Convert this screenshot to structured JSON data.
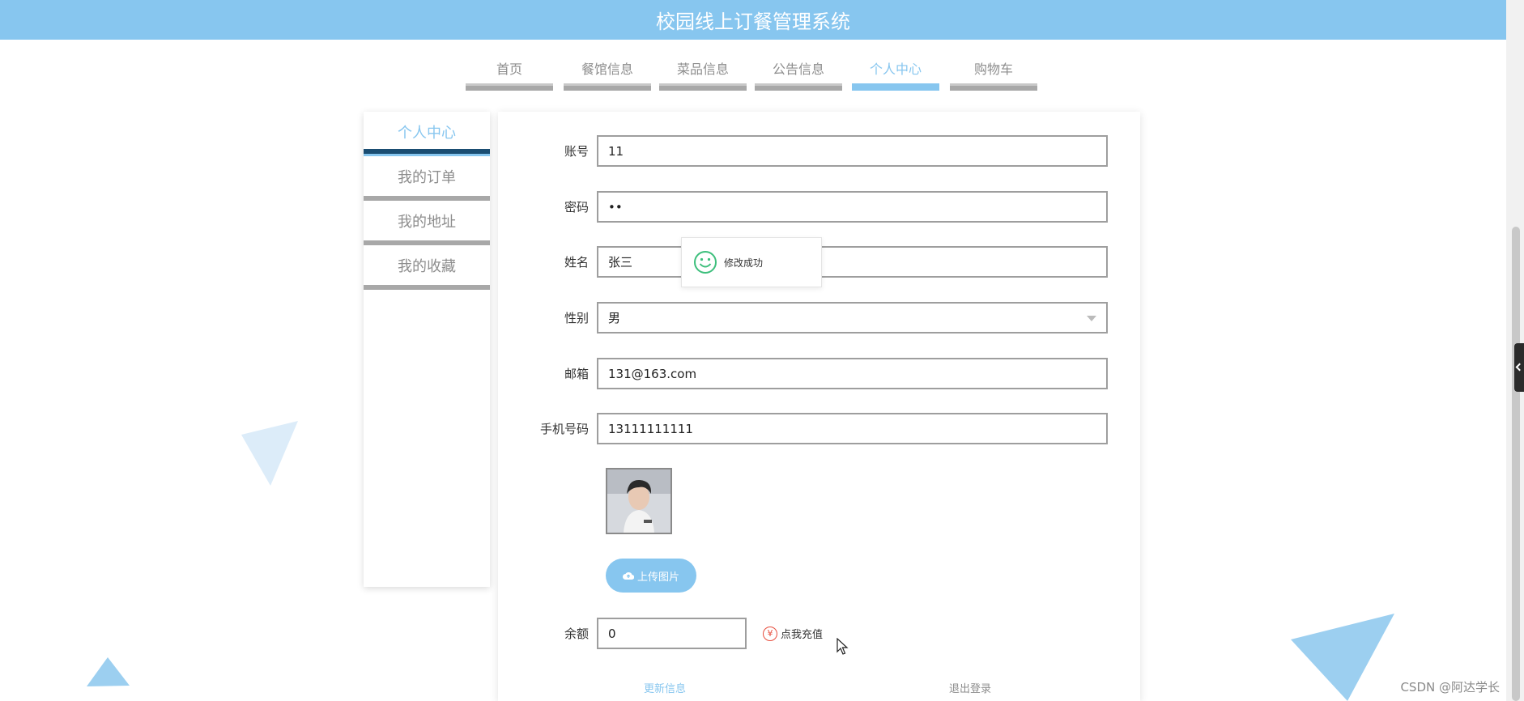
{
  "app": {
    "title": "校园线上订餐管理系统"
  },
  "nav": {
    "items": [
      {
        "label": "首页"
      },
      {
        "label": "餐馆信息"
      },
      {
        "label": "菜品信息"
      },
      {
        "label": "公告信息"
      },
      {
        "label": "个人中心"
      },
      {
        "label": "购物车"
      }
    ],
    "active_index": 4
  },
  "sidebar": {
    "items": [
      {
        "label": "个人中心"
      },
      {
        "label": "我的订单"
      },
      {
        "label": "我的地址"
      },
      {
        "label": "我的收藏"
      }
    ],
    "active_index": 0
  },
  "form": {
    "account": {
      "label": "账号",
      "value": "11"
    },
    "password": {
      "label": "密码",
      "value": "••"
    },
    "name": {
      "label": "姓名",
      "value": "张三"
    },
    "gender": {
      "label": "性别",
      "value": "男"
    },
    "email": {
      "label": "邮箱",
      "value": "131@163.com"
    },
    "phone": {
      "label": "手机号码",
      "value": "13111111111"
    },
    "upload_button": "上传图片",
    "balance": {
      "label": "余额",
      "value": "0"
    },
    "recharge_label": "点我充值",
    "update_label": "更新信息",
    "logout_label": "退出登录"
  },
  "toast": {
    "message": "修改成功"
  },
  "watermark": "CSDN @阿达学长",
  "colors": {
    "accent": "#87c6ef",
    "active_bar": "#1a4d72",
    "success": "#3dbf7c",
    "recharge": "#e74c3c"
  }
}
